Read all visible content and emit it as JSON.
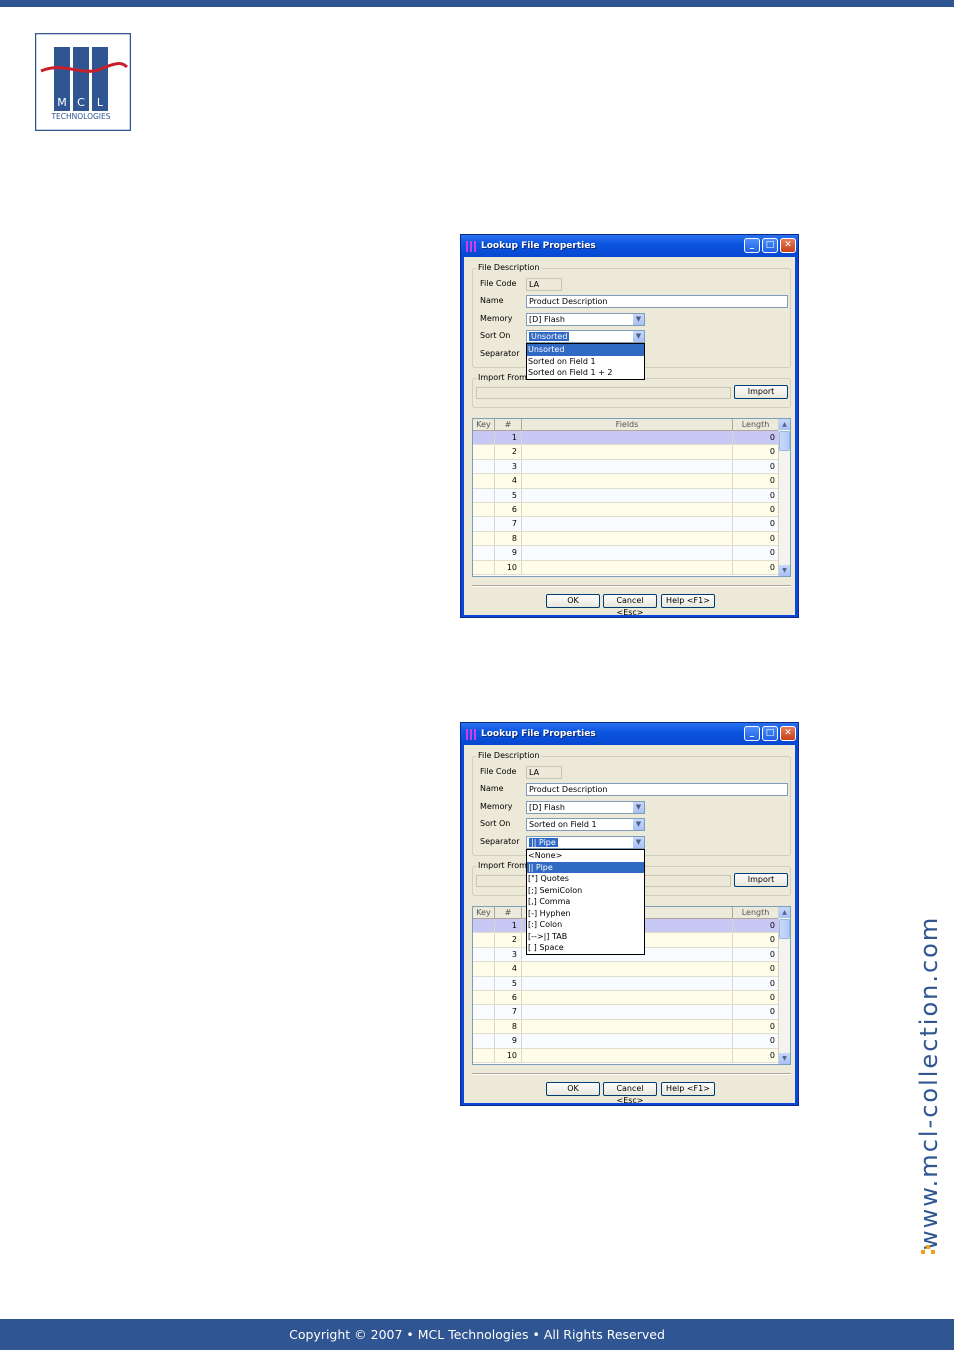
{
  "footer": {
    "copyright": "Copyright © 2007 • MCL Technologies • All Rights Reserved"
  },
  "logo": {
    "letters": [
      "M",
      "C",
      "L"
    ],
    "subtitle": "TECHNOLOGIES"
  },
  "side_url": "www.mcl-collection.com",
  "colors": {
    "brand_blue": "#2f5592",
    "titlebar_blue": "#0a55e0",
    "selection": "#316ac5",
    "dots_orange": "#f0a020"
  },
  "dialogs": [
    {
      "title": "Lookup File Properties",
      "file_description_legend": "File Description",
      "file_code_label": "File Code",
      "file_code_value": "LA",
      "name_label": "Name",
      "name_value": "Product Description",
      "memory_label": "Memory",
      "memory_value": "[D] Flash",
      "sort_on_label": "Sort On",
      "sort_on_value": "Unsorted",
      "separator_label": "Separator",
      "import_from_legend": "Import From",
      "import_button": "Import",
      "dropdown_items": [
        "Unsorted",
        "Sorted on Field 1",
        "Sorted on Field 1 + 2"
      ],
      "dropdown_highlight_index": 0,
      "ok_button": "OK",
      "cancel_button": "Cancel <Esc>",
      "help_button": "Help <F1>"
    },
    {
      "title": "Lookup File Properties",
      "file_description_legend": "File Description",
      "file_code_label": "File Code",
      "file_code_value": "LA",
      "name_label": "Name",
      "name_value": "Product Description",
      "memory_label": "Memory",
      "memory_value": "[D] Flash",
      "sort_on_label": "Sort On",
      "sort_on_value": "Sorted on Field 1",
      "separator_label": "Separator",
      "separator_value": "|| Pipe",
      "import_from_legend": "Import From",
      "import_button": "Import",
      "dropdown_items": [
        "<None>",
        "|| Pipe",
        "[\"] Quotes",
        "[;] SemiColon",
        "[,] Comma",
        "[-] Hyphen",
        "[:] Colon",
        "[-->|] TAB",
        "[ ] Space"
      ],
      "dropdown_highlight_index": 1,
      "ok_button": "OK",
      "cancel_button": "Cancel <Esc>",
      "help_button": "Help <F1>"
    }
  ],
  "grid": {
    "columns": [
      "Key",
      "#",
      "Fields",
      "Length"
    ],
    "rows": [
      {
        "num": "1",
        "length": "0"
      },
      {
        "num": "2",
        "length": "0"
      },
      {
        "num": "3",
        "length": "0"
      },
      {
        "num": "4",
        "length": "0"
      },
      {
        "num": "5",
        "length": "0"
      },
      {
        "num": "6",
        "length": "0"
      },
      {
        "num": "7",
        "length": "0"
      },
      {
        "num": "8",
        "length": "0"
      },
      {
        "num": "9",
        "length": "0"
      },
      {
        "num": "10",
        "length": "0"
      }
    ]
  }
}
